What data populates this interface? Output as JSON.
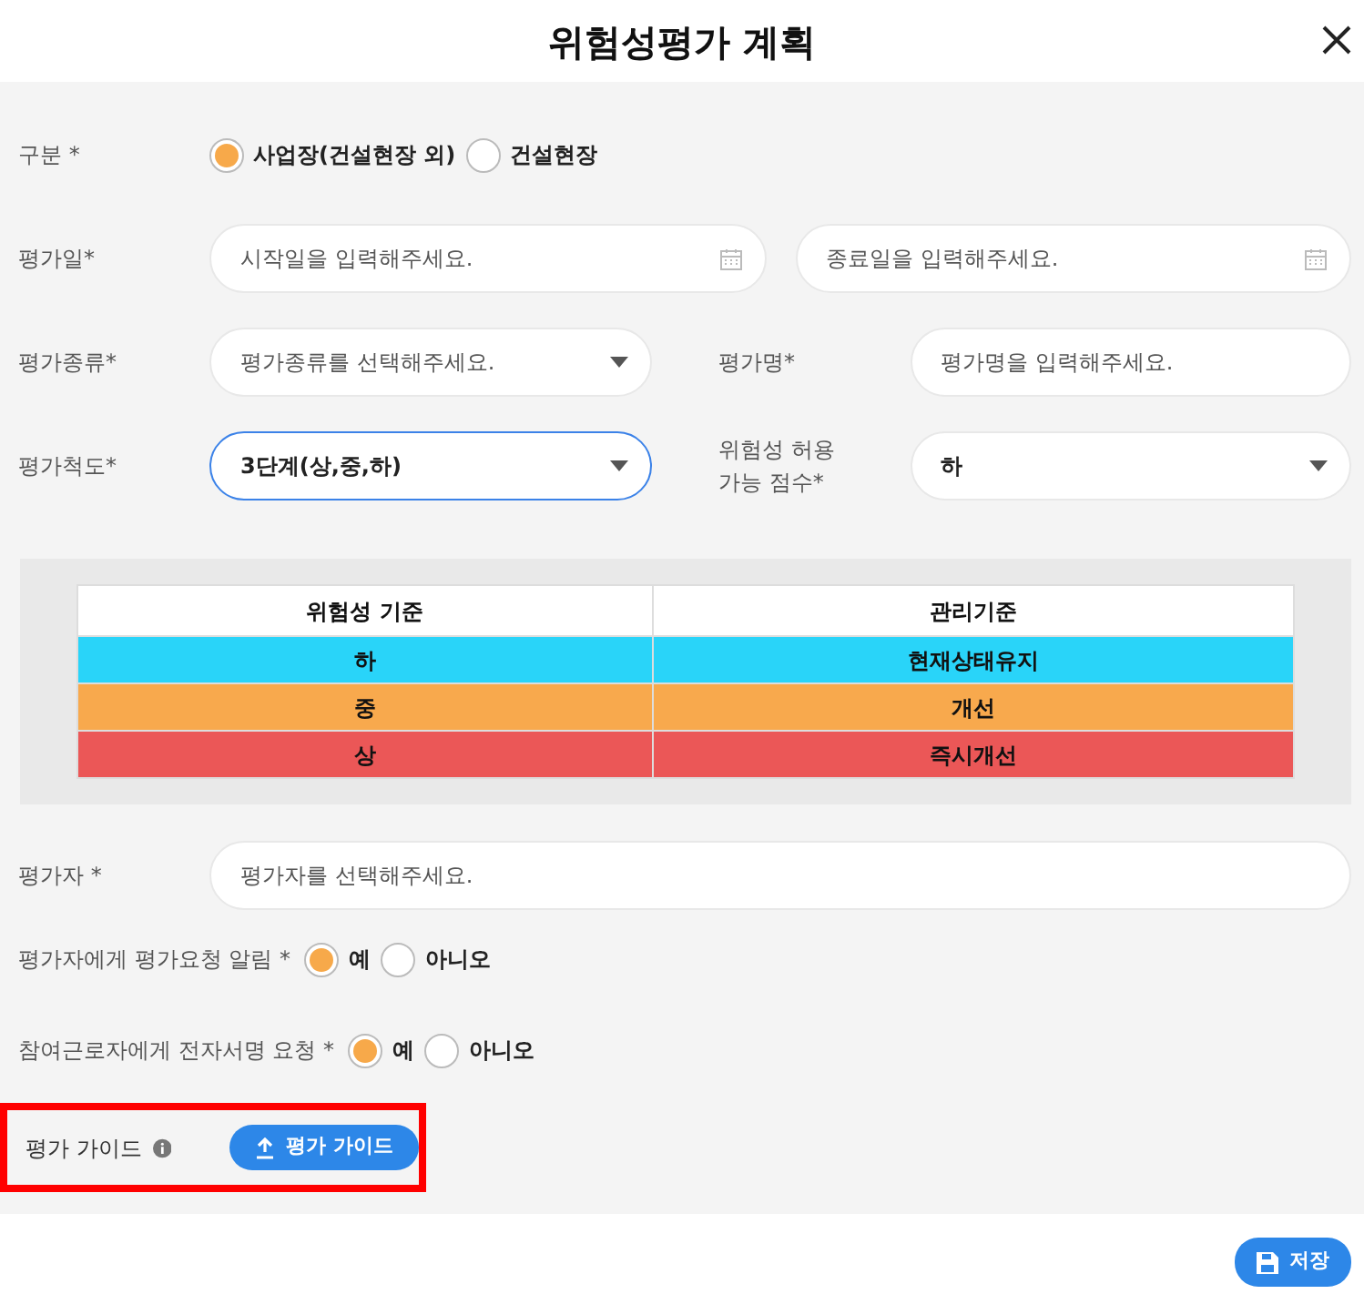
{
  "title": "위험성평가 계획",
  "rows": [
    {
      "kind": "radio",
      "label": "구분 *",
      "options": [
        {
          "label": "사업장(건설현장 외)",
          "selected": true
        },
        {
          "label": "건설현장",
          "selected": false
        }
      ]
    },
    {
      "kind": "date_range",
      "label": "평가일*",
      "start": {
        "placeholder": "시작일을 입력해주세요."
      },
      "end": {
        "placeholder": "종료일을 입력해주세요."
      }
    },
    {
      "kind": "pair",
      "items": [
        {
          "label": "평가종류*",
          "control": {
            "kind": "select",
            "placeholder": "평가종류를 선택해주세요.",
            "focused": false
          }
        },
        {
          "label": "평가명*",
          "control": {
            "kind": "input",
            "placeholder": "평가명을 입력해주세요.",
            "focused": false
          }
        }
      ]
    },
    {
      "kind": "pair",
      "items": [
        {
          "label": "평가척도*",
          "control": {
            "kind": "select",
            "value": "3단계(상,중,하)",
            "focused": true
          }
        },
        {
          "label": "위험성 허용 가능 점수*",
          "control": {
            "kind": "select",
            "value": "하",
            "focused": false
          }
        }
      ]
    },
    {
      "kind": "table",
      "columns": [
        "위험성 기준",
        "관리기준"
      ],
      "rows": [
        {
          "color": "#29d4f9",
          "cells": [
            "하",
            "현재상태유지"
          ]
        },
        {
          "color": "#f8a94d",
          "cells": [
            "중",
            "개선"
          ]
        },
        {
          "color": "#eb5757",
          "cells": [
            "상",
            "즉시개선"
          ]
        }
      ]
    },
    {
      "kind": "input",
      "label": "평가자 *",
      "placeholder": "평가자를 선택해주세요."
    },
    {
      "kind": "radio_inline",
      "label": "평가자에게 평가요청 알림 *",
      "options": [
        {
          "label": "예",
          "selected": true
        },
        {
          "label": "아니오",
          "selected": false
        }
      ]
    },
    {
      "kind": "radio_inline",
      "label": "참여근로자에게 전자서명 요청 *",
      "options": [
        {
          "label": "예",
          "selected": true
        },
        {
          "label": "아니오",
          "selected": false
        }
      ]
    },
    {
      "kind": "upload",
      "label": "평가 가이드",
      "button": "평가 가이드",
      "highlighted": true
    }
  ],
  "save_button": "저장"
}
